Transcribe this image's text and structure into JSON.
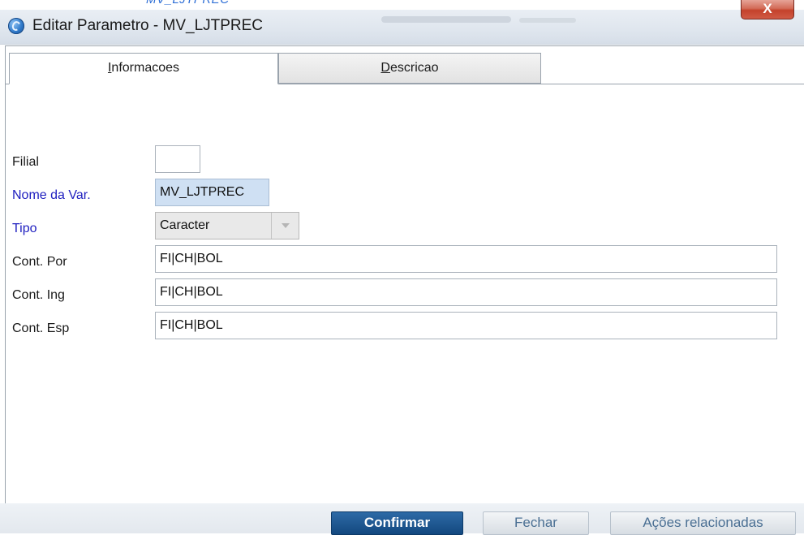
{
  "window": {
    "title": "Editar Parametro - MV_LJTPREC",
    "close_label": "X",
    "top_caption": "MV_LJTPREC"
  },
  "tabs": [
    {
      "prefix": "",
      "accel": "I",
      "rest": "nformacoes",
      "active": true
    },
    {
      "prefix": "",
      "accel": "D",
      "rest": "escricao",
      "active": false
    }
  ],
  "form": {
    "filial": {
      "label": "Filial",
      "value": ""
    },
    "nome_var": {
      "label": "Nome da Var.",
      "value": "MV_LJTPREC"
    },
    "tipo": {
      "label": "Tipo",
      "value": "Caracter",
      "options_visible": [
        "Caracter"
      ]
    },
    "cont_por": {
      "label": "Cont. Por",
      "value": "FI|CH|BOL"
    },
    "cont_ing": {
      "label": "Cont. Ing",
      "value": "FI|CH|BOL"
    },
    "cont_esp": {
      "label": "Cont. Esp",
      "value": "FI|CH|BOL"
    }
  },
  "buttons": {
    "confirmar": "Confirmar",
    "fechar": "Fechar",
    "acoes": "Ações relacionadas"
  },
  "colors": {
    "required_label": "#2020c0",
    "primary_button": "#13487f",
    "close_button": "#c4422c"
  },
  "icons": {
    "app": "app-logo-icon",
    "close": "close-icon",
    "dropdown": "chevron-down-icon"
  }
}
